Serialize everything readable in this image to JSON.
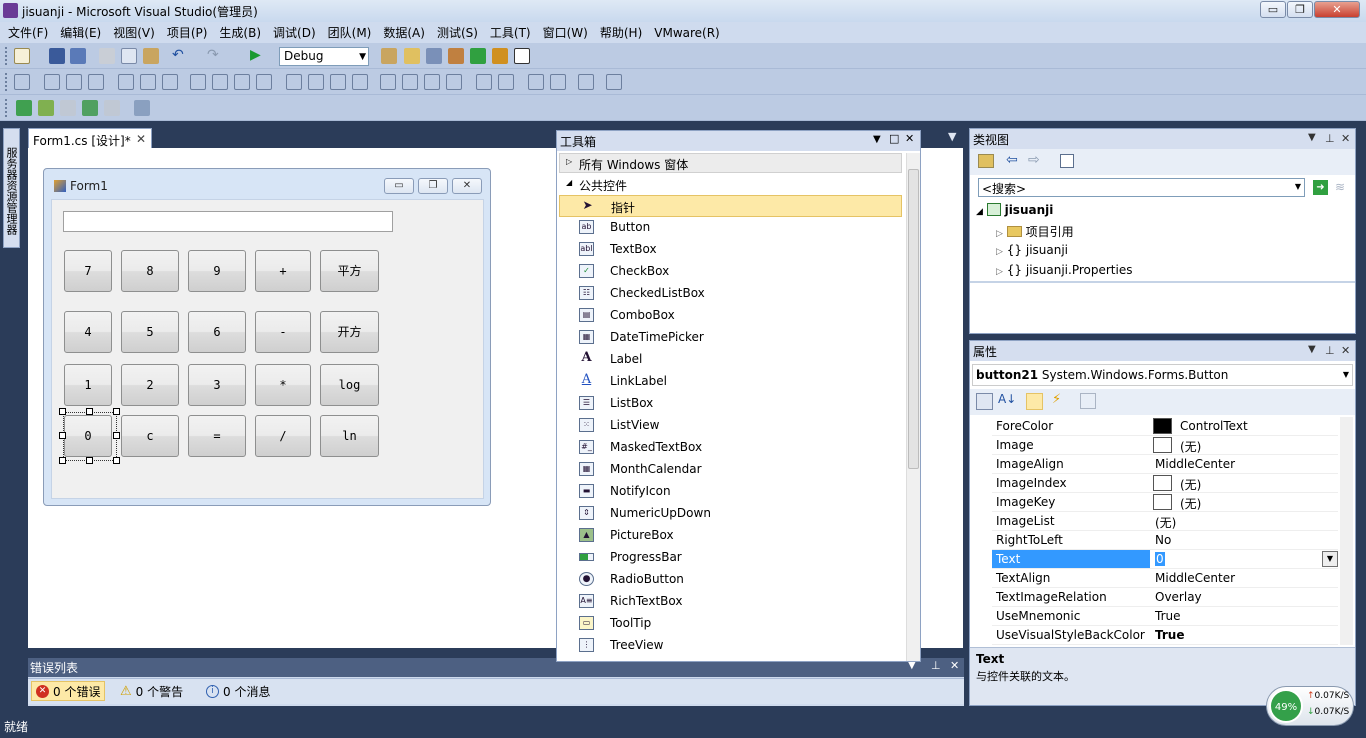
{
  "window": {
    "title": "jisuanji - Microsoft Visual Studio(管理员)",
    "min_label": "▭",
    "max_label": "❐",
    "close_label": "✕"
  },
  "menu": [
    "文件(F)",
    "编辑(E)",
    "视图(V)",
    "项目(P)",
    "生成(B)",
    "调试(D)",
    "团队(M)",
    "数据(A)",
    "测试(S)",
    "工具(T)",
    "窗口(W)",
    "帮助(H)",
    "VMware(R)"
  ],
  "toolbar": {
    "config": "Debug"
  },
  "side": {
    "server_explorer": "服务器资源管理器"
  },
  "doc": {
    "tab_label": "Form1.cs [设计]*"
  },
  "form": {
    "title": "Form1",
    "display_value": "",
    "buttons": [
      "7",
      "8",
      "9",
      "+",
      "平方",
      "4",
      "5",
      "6",
      "-",
      "开方",
      "1",
      "2",
      "3",
      "*",
      "log",
      "0",
      "c",
      "=",
      "/",
      "ln"
    ]
  },
  "toolbox": {
    "title": "工具箱",
    "group_all": "所有 Windows 窗体",
    "group_common": "公共控件",
    "items": [
      "指针",
      "Button",
      "TextBox",
      "CheckBox",
      "CheckedListBox",
      "ComboBox",
      "DateTimePicker",
      "Label",
      "LinkLabel",
      "ListBox",
      "ListView",
      "MaskedTextBox",
      "MonthCalendar",
      "NotifyIcon",
      "NumericUpDown",
      "PictureBox",
      "ProgressBar",
      "RadioButton",
      "RichTextBox",
      "ToolTip",
      "TreeView"
    ]
  },
  "classview": {
    "title": "类视图",
    "search_placeholder": "<搜索>",
    "tree": [
      {
        "label": "jisuanji",
        "bold": true
      },
      {
        "label": "项目引用"
      },
      {
        "label": "jisuanji"
      },
      {
        "label": "jisuanji.Properties"
      }
    ]
  },
  "properties": {
    "title": "属性",
    "object": "button21",
    "object_type": "System.Windows.Forms.Button",
    "rows": [
      {
        "name": "ForeColor",
        "value": "ControlText"
      },
      {
        "name": "Image",
        "value": "(无)"
      },
      {
        "name": "ImageAlign",
        "value": "MiddleCenter"
      },
      {
        "name": "ImageIndex",
        "value": "(无)"
      },
      {
        "name": "ImageKey",
        "value": "(无)"
      },
      {
        "name": "ImageList",
        "value": "(无)"
      },
      {
        "name": "RightToLeft",
        "value": "No"
      },
      {
        "name": "Text",
        "value": "0"
      },
      {
        "name": "TextAlign",
        "value": "MiddleCenter"
      },
      {
        "name": "TextImageRelation",
        "value": "Overlay"
      },
      {
        "name": "UseMnemonic",
        "value": "True"
      },
      {
        "name": "UseVisualStyleBackColor",
        "value": "True"
      }
    ],
    "desc_title": "Text",
    "desc_text": "与控件关联的文本。"
  },
  "errors": {
    "title": "错误列表",
    "errors": "0 个错误",
    "warnings": "0 个警告",
    "messages": "0 个消息"
  },
  "status": {
    "text": "就绪"
  },
  "netmon": {
    "percent": "49%",
    "up": "0.07K/S",
    "down": "0.07K/S"
  },
  "colors": {
    "accent": "#3399ff",
    "selected_tool": "#fde9a7",
    "chrome": "#2b3c59"
  }
}
